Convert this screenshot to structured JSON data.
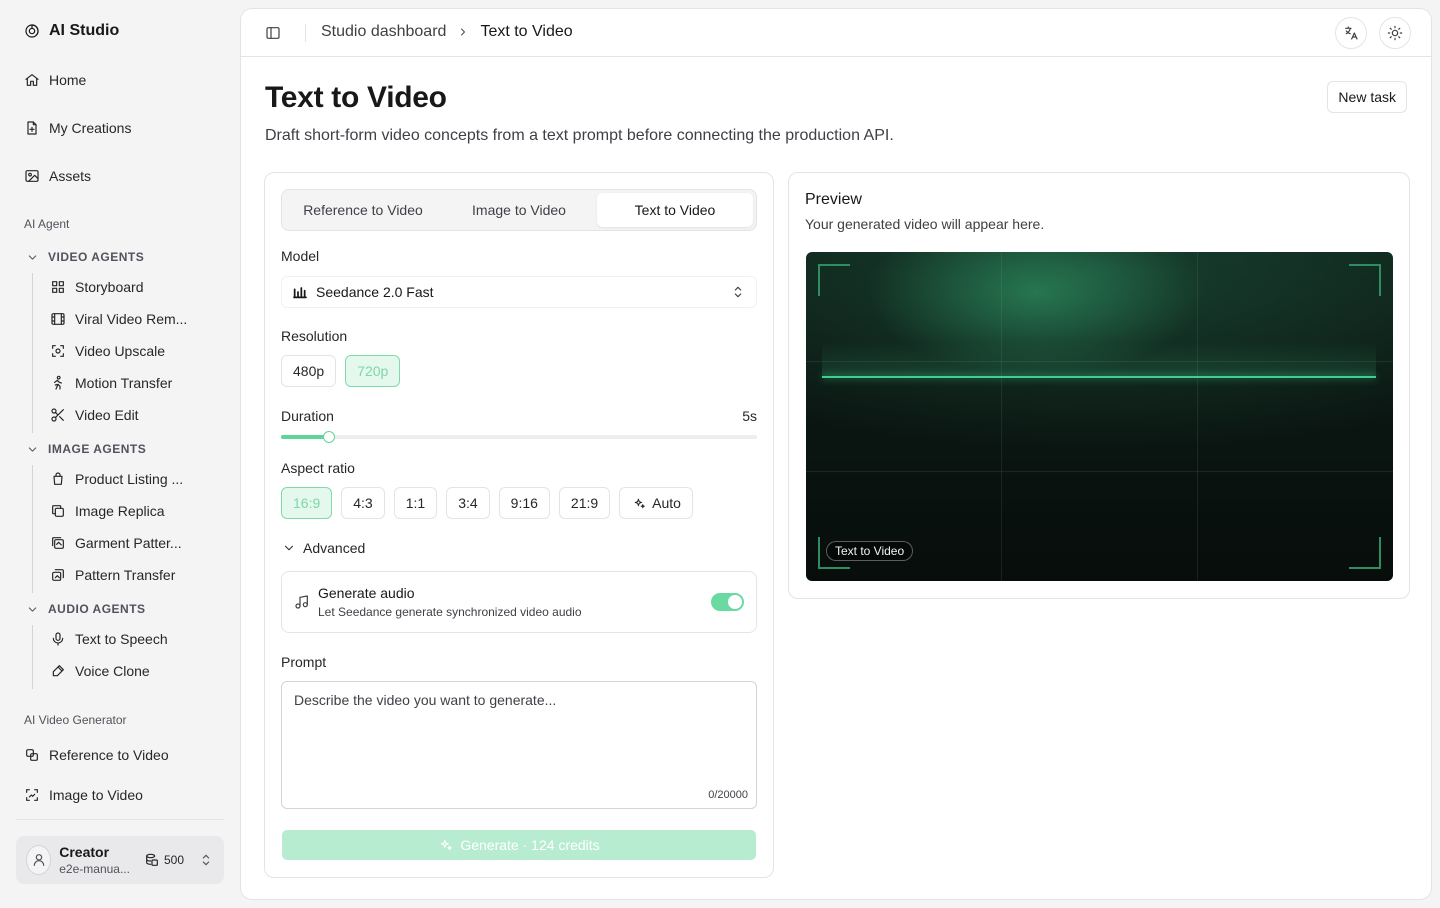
{
  "app": {
    "name": "AI Studio"
  },
  "sidebar": {
    "top_items": [
      {
        "label": "Home",
        "icon": "home-icon"
      },
      {
        "label": "My Creations",
        "icon": "file-icon"
      },
      {
        "label": "Assets",
        "icon": "image-icon"
      }
    ],
    "ai_agent_label": "AI Agent",
    "video_agents": {
      "title": "VIDEO AGENTS",
      "items": [
        "Storyboard",
        "Viral Video Rem...",
        "Video Upscale",
        "Motion Transfer",
        "Video Edit"
      ]
    },
    "image_agents": {
      "title": "IMAGE AGENTS",
      "items": [
        "Product Listing ...",
        "Image Replica",
        "Garment Patter...",
        "Pattern Transfer"
      ]
    },
    "audio_agents": {
      "title": "AUDIO AGENTS",
      "items": [
        "Text to Speech",
        "Voice Clone"
      ]
    },
    "generator_label": "AI Video Generator",
    "generator_items": [
      "Reference to Video",
      "Image to Video"
    ],
    "user": {
      "name": "Creator",
      "email": "e2e-manua...",
      "credits": "500"
    }
  },
  "header": {
    "breadcrumb_parent": "Studio dashboard",
    "breadcrumb_current": "Text to Video"
  },
  "page": {
    "title": "Text to Video",
    "subtitle": "Draft short-form video concepts from a text prompt before connecting the production API.",
    "new_task_label": "New task"
  },
  "form": {
    "tabs": [
      "Reference to Video",
      "Image to Video",
      "Text to Video"
    ],
    "active_tab": "Text to Video",
    "model_label": "Model",
    "model_value": "Seedance 2.0 Fast",
    "resolution_label": "Resolution",
    "resolutions": [
      "480p",
      "720p"
    ],
    "selected_resolution": "720p",
    "duration_label": "Duration",
    "duration_value": "5s",
    "duration_fraction": 0.1,
    "aspect_label": "Aspect ratio",
    "aspect_ratios": [
      "16:9",
      "4:3",
      "1:1",
      "3:4",
      "9:16",
      "21:9",
      "Auto"
    ],
    "selected_aspect": "16:9",
    "advanced_label": "Advanced",
    "audio_title": "Generate audio",
    "audio_desc": "Let Seedance generate synchronized video audio",
    "audio_enabled": true,
    "prompt_label": "Prompt",
    "prompt_placeholder": "Describe the video you want to generate...",
    "prompt_count": "0/20000",
    "generate_label": "Generate · 124 credits"
  },
  "preview": {
    "title": "Preview",
    "subtitle": "Your generated video will appear here.",
    "tag": "Text to Video"
  },
  "colors": {
    "accent": "#5ed59a",
    "accent_soft": "#e5f8ee",
    "generate_button": "#b8ecd1"
  }
}
